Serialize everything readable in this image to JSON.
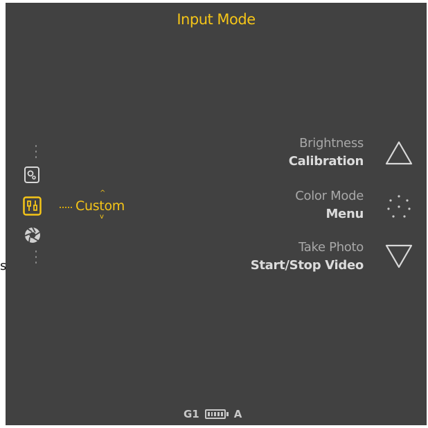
{
  "header": {
    "title": "Input Mode"
  },
  "edge_text": "s",
  "mode_selector": {
    "selected_label": "Custom",
    "up_chevron": "^",
    "down_chevron": "v",
    "items": [
      {
        "name": "image-settings",
        "icon": "settings-cards-icon",
        "selected": false
      },
      {
        "name": "custom",
        "icon": "custom-sliders-icon",
        "selected": true
      },
      {
        "name": "aperture",
        "icon": "aperture-icon",
        "selected": false
      }
    ]
  },
  "controls": {
    "up": {
      "line1": "Brightness",
      "line2": "Calibration",
      "icon": "triangle-up-icon"
    },
    "middle": {
      "line1": "Color Mode",
      "line2": "Menu",
      "icon": "dots-ring-icon"
    },
    "down": {
      "line1": "Take Photo",
      "line2": "Start/Stop Video",
      "icon": "triangle-down-icon"
    }
  },
  "status_bar": {
    "profile": "G1",
    "battery_level": 1.0,
    "mode": "A"
  },
  "colors": {
    "background": "#414141",
    "accent": "#f5c518",
    "text_light": "#a8a8a8",
    "text_bold": "#dcdcdc"
  }
}
